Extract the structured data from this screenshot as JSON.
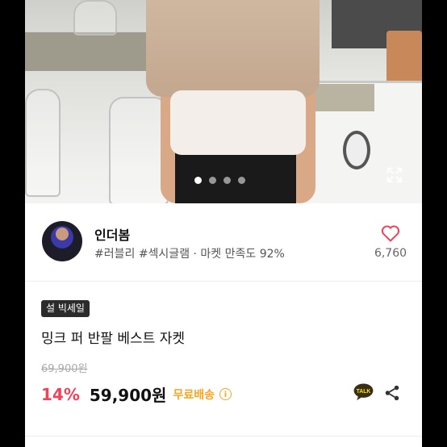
{
  "gallery": {
    "slide_count": 4,
    "active_index": 0
  },
  "seller": {
    "name": "인더봄",
    "tags": "#러블리 #섹시글램 · 마켓 만족도 92%",
    "likes": "6,760"
  },
  "product": {
    "badge": "설 빅세일",
    "title": "밍크 퍼 반팔 베스트 자켓",
    "original_price": "69,900원",
    "discount": "14%",
    "price": "59,900원",
    "shipping": "무료배송",
    "info_symbol": "i",
    "talk_label": "TALK"
  },
  "colors": {
    "discount": "#f0425b",
    "shipping": "#f5a623",
    "heart": "#f0425b"
  },
  "icons": [
    "expand-icon",
    "heart-icon",
    "info-icon",
    "kakao-talk-icon",
    "share-icon"
  ]
}
